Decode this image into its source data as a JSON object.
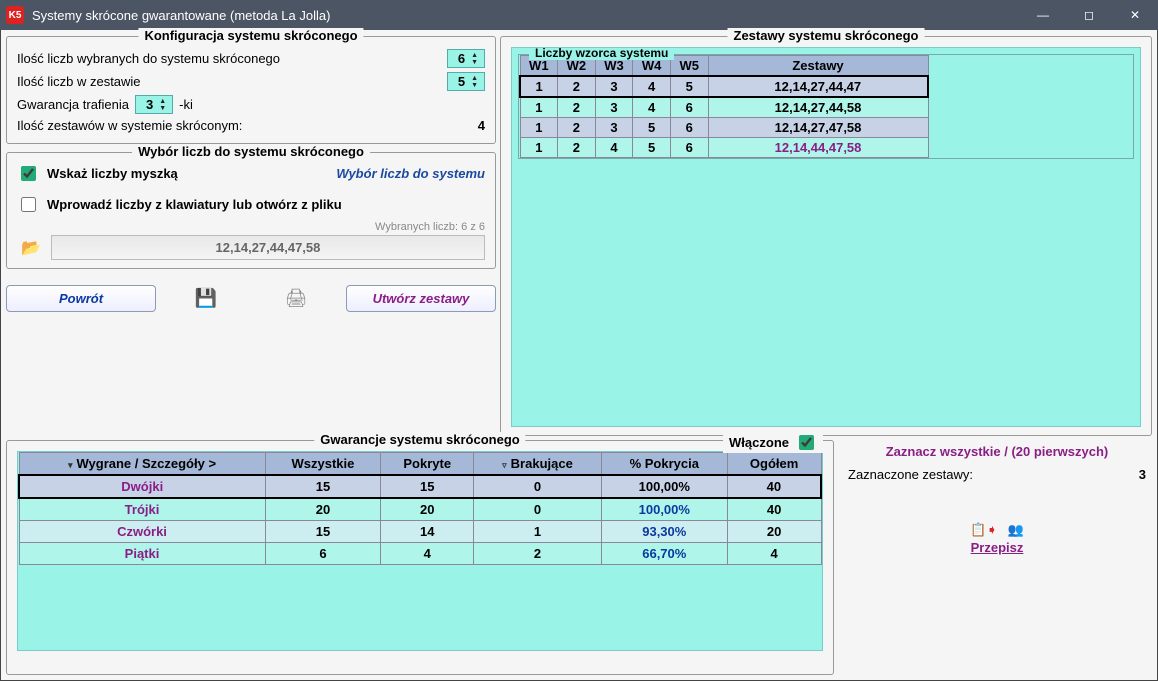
{
  "title": "Systemy skrócone gwarantowane (metoda La Jolla)",
  "app_icon": "K5",
  "config": {
    "legend": "Konfiguracja systemu skróconego",
    "num_selected_label": "Ilość liczb wybranych do systemu skróconego",
    "num_selected_value": "6",
    "num_in_set_label": "Ilość liczb w zestawie",
    "num_in_set_value": "5",
    "hit_label_before": "Gwarancja trafienia",
    "hit_value": "3",
    "hit_label_after": "-ki",
    "sets_count_label": "Ilość zestawów w systemie skróconym:",
    "sets_count_value": "4"
  },
  "choice": {
    "legend": "Wybór liczb do systemu skróconego",
    "opt_mouse": "Wskaż liczby myszką",
    "opt_mouse_checked": true,
    "right_hint": "Wybór liczb do systemu",
    "opt_keyboard": "Wprowadź liczby z klawiatury lub otwórz z pliku",
    "opt_keyboard_checked": false,
    "selected_info": "Wybranych liczb: 6 z 6",
    "numbers": "12,14,27,44,47,58"
  },
  "buttons": {
    "back": "Powrót",
    "create": "Utwórz zestawy"
  },
  "sets_panel": {
    "legend": "Zestawy systemu skróconego",
    "inner_legend": "Liczby wzorca systemu",
    "headers": [
      "W1",
      "W2",
      "W3",
      "W4",
      "W5"
    ],
    "zest_header": "Zestawy",
    "rows": [
      {
        "w": [
          "1",
          "2",
          "3",
          "4",
          "5"
        ],
        "z": "12,14,27,44,47"
      },
      {
        "w": [
          "1",
          "2",
          "3",
          "4",
          "6"
        ],
        "z": "12,14,27,44,58"
      },
      {
        "w": [
          "1",
          "2",
          "3",
          "5",
          "6"
        ],
        "z": "12,14,27,47,58"
      },
      {
        "w": [
          "1",
          "2",
          "4",
          "5",
          "6"
        ],
        "z": "12,14,44,47,58"
      }
    ]
  },
  "guarantee": {
    "legend": "Gwarancje systemu skróconego",
    "enabled_label": "Włączone",
    "enabled": true,
    "headers": {
      "col1": "Wygrane / Szczegóły >",
      "all": "Wszystkie",
      "covered": "Pokryte",
      "missing": "Brakujące",
      "pct": "% Pokrycia",
      "total": "Ogółem"
    },
    "rows": [
      {
        "name": "Dwójki",
        "all": "15",
        "cov": "15",
        "mis": "0",
        "pct": "100,00%",
        "tot": "40",
        "class": "sel",
        "pct_class": ""
      },
      {
        "name": "Trójki",
        "all": "20",
        "cov": "20",
        "mis": "0",
        "pct": "100,00%",
        "tot": "40",
        "class": "alt",
        "pct_class": "blue-text"
      },
      {
        "name": "Czwórki",
        "all": "15",
        "cov": "14",
        "mis": "1",
        "pct": "93,30%",
        "tot": "20",
        "class": "alt2",
        "pct_class": "blue-text"
      },
      {
        "name": "Piątki",
        "all": "6",
        "cov": "4",
        "mis": "2",
        "pct": "66,70%",
        "tot": "4",
        "class": "alt",
        "pct_class": "blue-text"
      }
    ]
  },
  "side": {
    "select_all": "Zaznacz wszystkie / (20 pierwszych)",
    "selected_label": "Zaznaczone zestawy:",
    "selected_value": "3",
    "przepisz": "Przepisz"
  }
}
